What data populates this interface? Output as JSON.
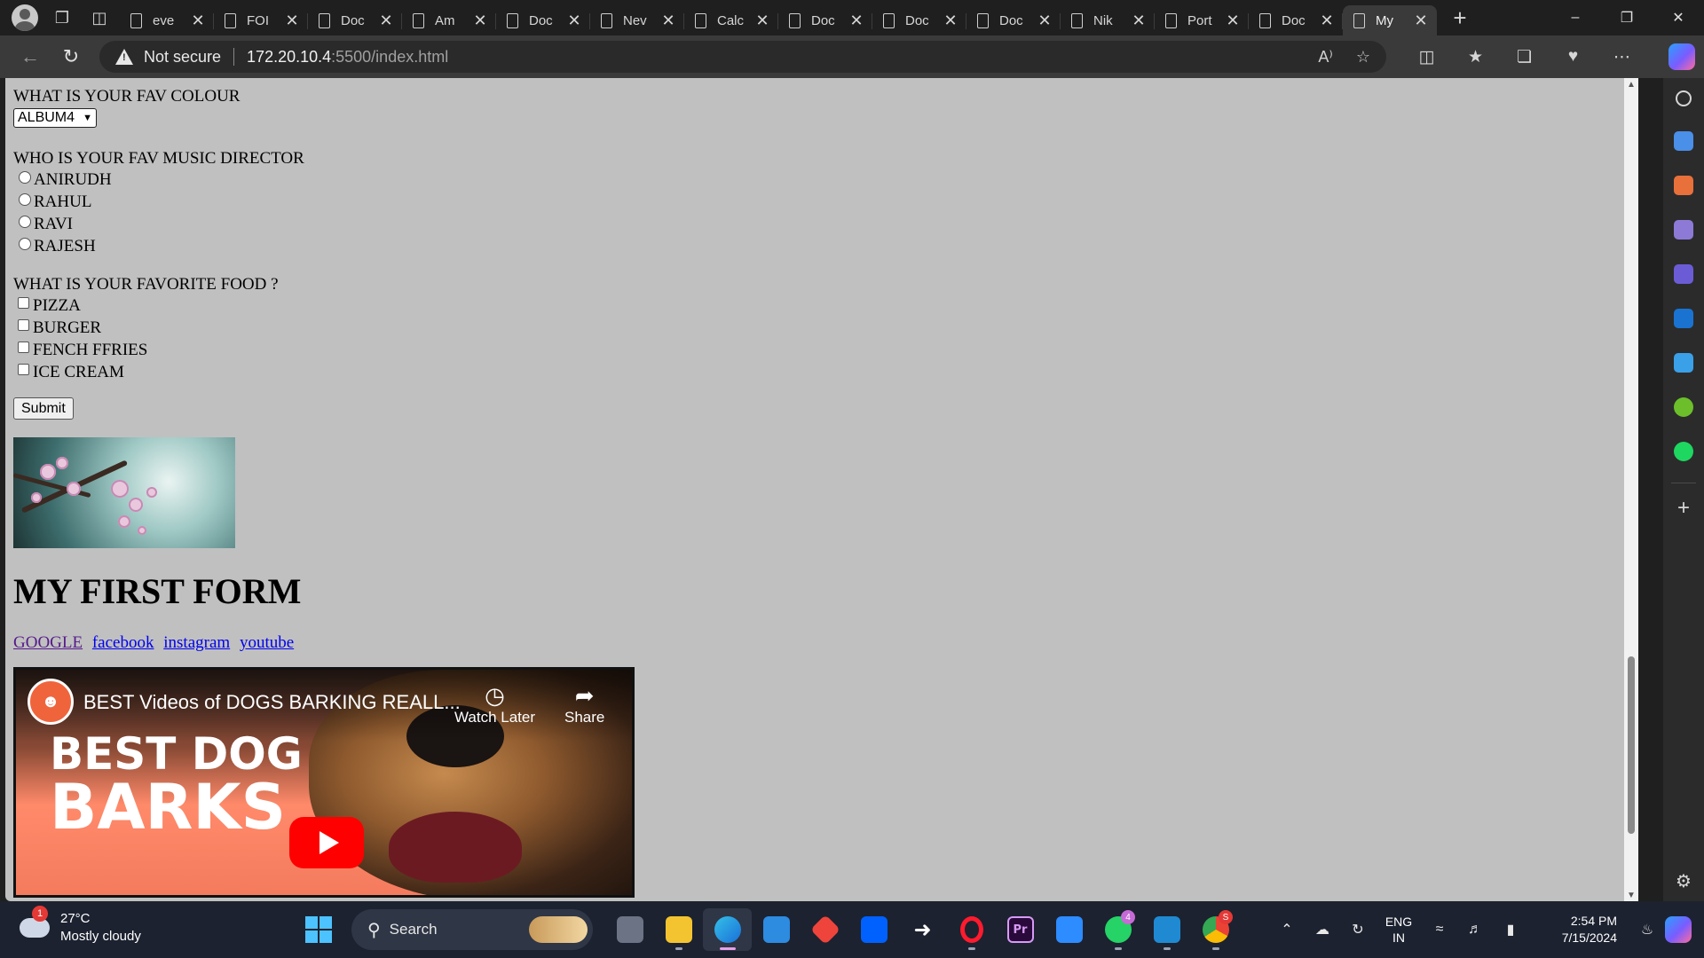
{
  "browser": {
    "tabs": [
      {
        "title": "eve",
        "active": false
      },
      {
        "title": "FOI",
        "active": false
      },
      {
        "title": "Doc",
        "active": false
      },
      {
        "title": "Am",
        "active": false
      },
      {
        "title": "Doc",
        "active": false
      },
      {
        "title": "Nev",
        "active": false
      },
      {
        "title": "Calc",
        "active": false
      },
      {
        "title": "Doc",
        "active": false
      },
      {
        "title": "Doc",
        "active": false
      },
      {
        "title": "Doc",
        "active": false
      },
      {
        "title": "Nik",
        "active": false
      },
      {
        "title": "Port",
        "active": false
      },
      {
        "title": "Doc",
        "active": false
      },
      {
        "title": "My",
        "active": true
      }
    ],
    "security_label": "Not secure",
    "url_host": "172.20.10.4",
    "url_path": ":5500/index.html"
  },
  "page": {
    "q_colour": "WHAT IS YOUR FAV COLOUR",
    "colour_selected": "ALBUM4",
    "q_director": "WHO IS YOUR FAV MUSIC DIRECTOR",
    "directors": [
      "ANIRUDH",
      "RAHUL",
      "RAVI",
      "RAJESH"
    ],
    "q_food": "WHAT IS YOUR FAVORITE FOOD ?",
    "foods": [
      "PIZZA",
      "BURGER",
      "FENCH FFRIES",
      "ICE CREAM"
    ],
    "submit_label": "Submit",
    "heading": "MY FIRST FORM",
    "links": [
      "GOOGLE",
      "facebook",
      "instagram",
      "youtube"
    ],
    "video": {
      "title": "BEST Videos of DOGS BARKING REALL...",
      "watch_later": "Watch Later",
      "share": "Share",
      "thumb_line1": "BEST DOG",
      "thumb_line2": "BARKS"
    }
  },
  "taskbar": {
    "weather_badge": "1",
    "temperature": "27°C",
    "condition": "Mostly cloudy",
    "search_placeholder": "Search",
    "whatsapp_count": "4",
    "chrome_badge": "S",
    "lang_line1": "ENG",
    "lang_line2": "IN",
    "time": "2:54 PM",
    "date": "7/15/2024"
  },
  "colors": {
    "page_bg": "#c0c0c0",
    "link": "#0000ee",
    "visited_link": "#551a8b",
    "youtube_red": "#ff0000",
    "taskbar_bg": "#1c2230"
  }
}
